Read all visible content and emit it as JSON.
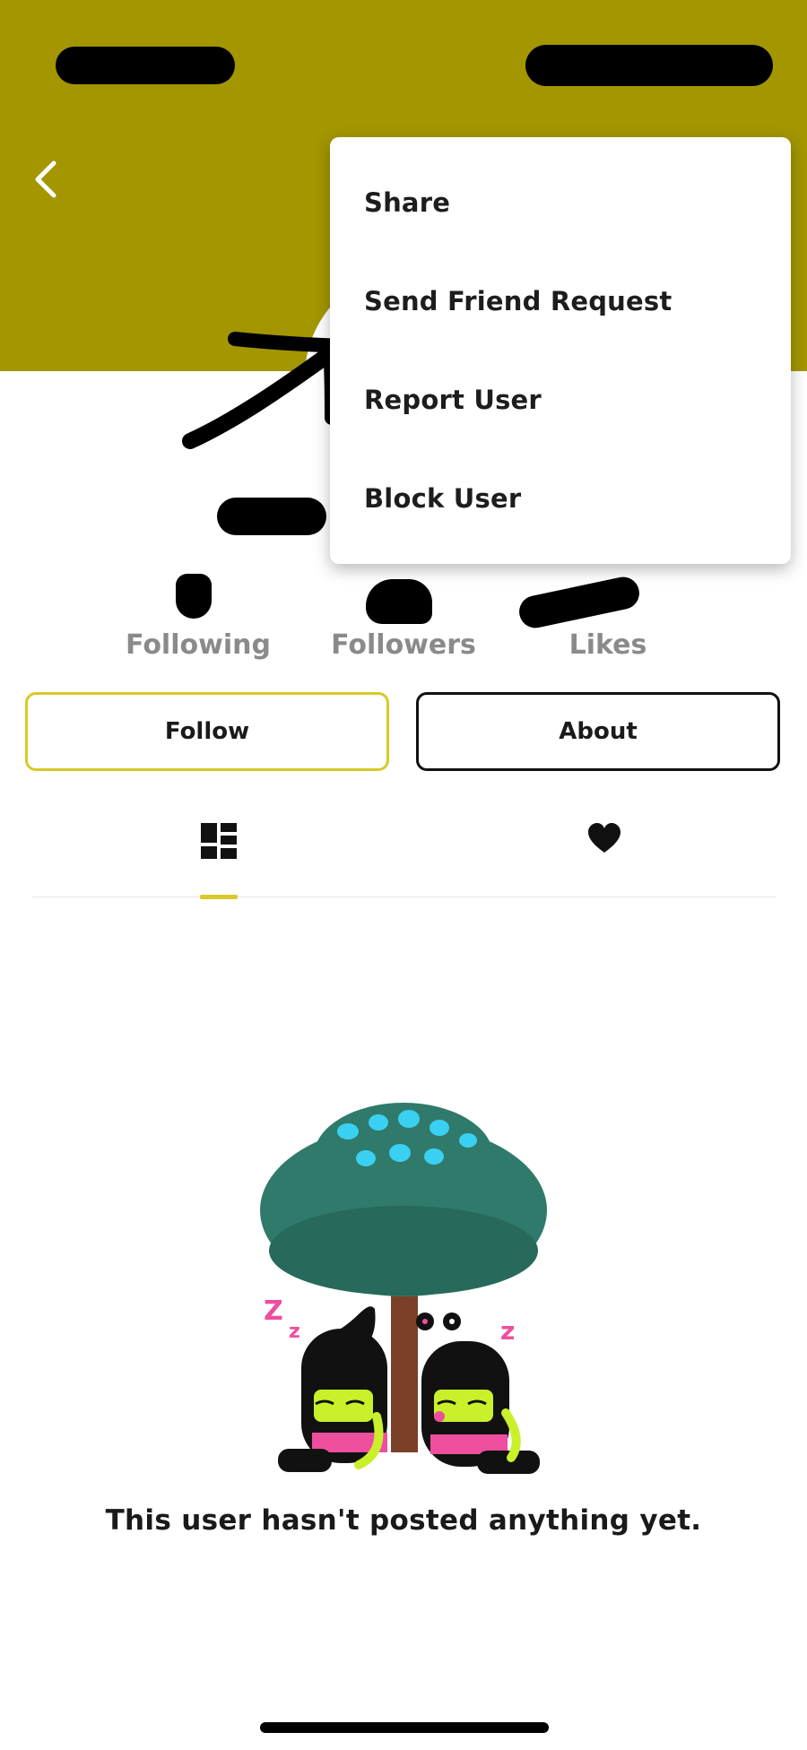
{
  "header": {
    "background_color": "#a39600",
    "back_icon": "chevron-left-icon"
  },
  "menu": {
    "items": [
      {
        "label": "Share"
      },
      {
        "label": "Send Friend Request"
      },
      {
        "label": "Report User"
      },
      {
        "label": "Block User"
      }
    ]
  },
  "stats": {
    "following_label": "Following",
    "followers_label": "Followers",
    "likes_label": "Likes"
  },
  "actions": {
    "follow_label": "Follow",
    "about_label": "About"
  },
  "tabs": {
    "posts_icon": "grid-icon",
    "likes_icon": "heart-icon",
    "active": "posts"
  },
  "empty_state": {
    "message": "This user hasn't posted anything yet."
  },
  "colors": {
    "accent": "#d8c928",
    "header": "#a39600"
  }
}
